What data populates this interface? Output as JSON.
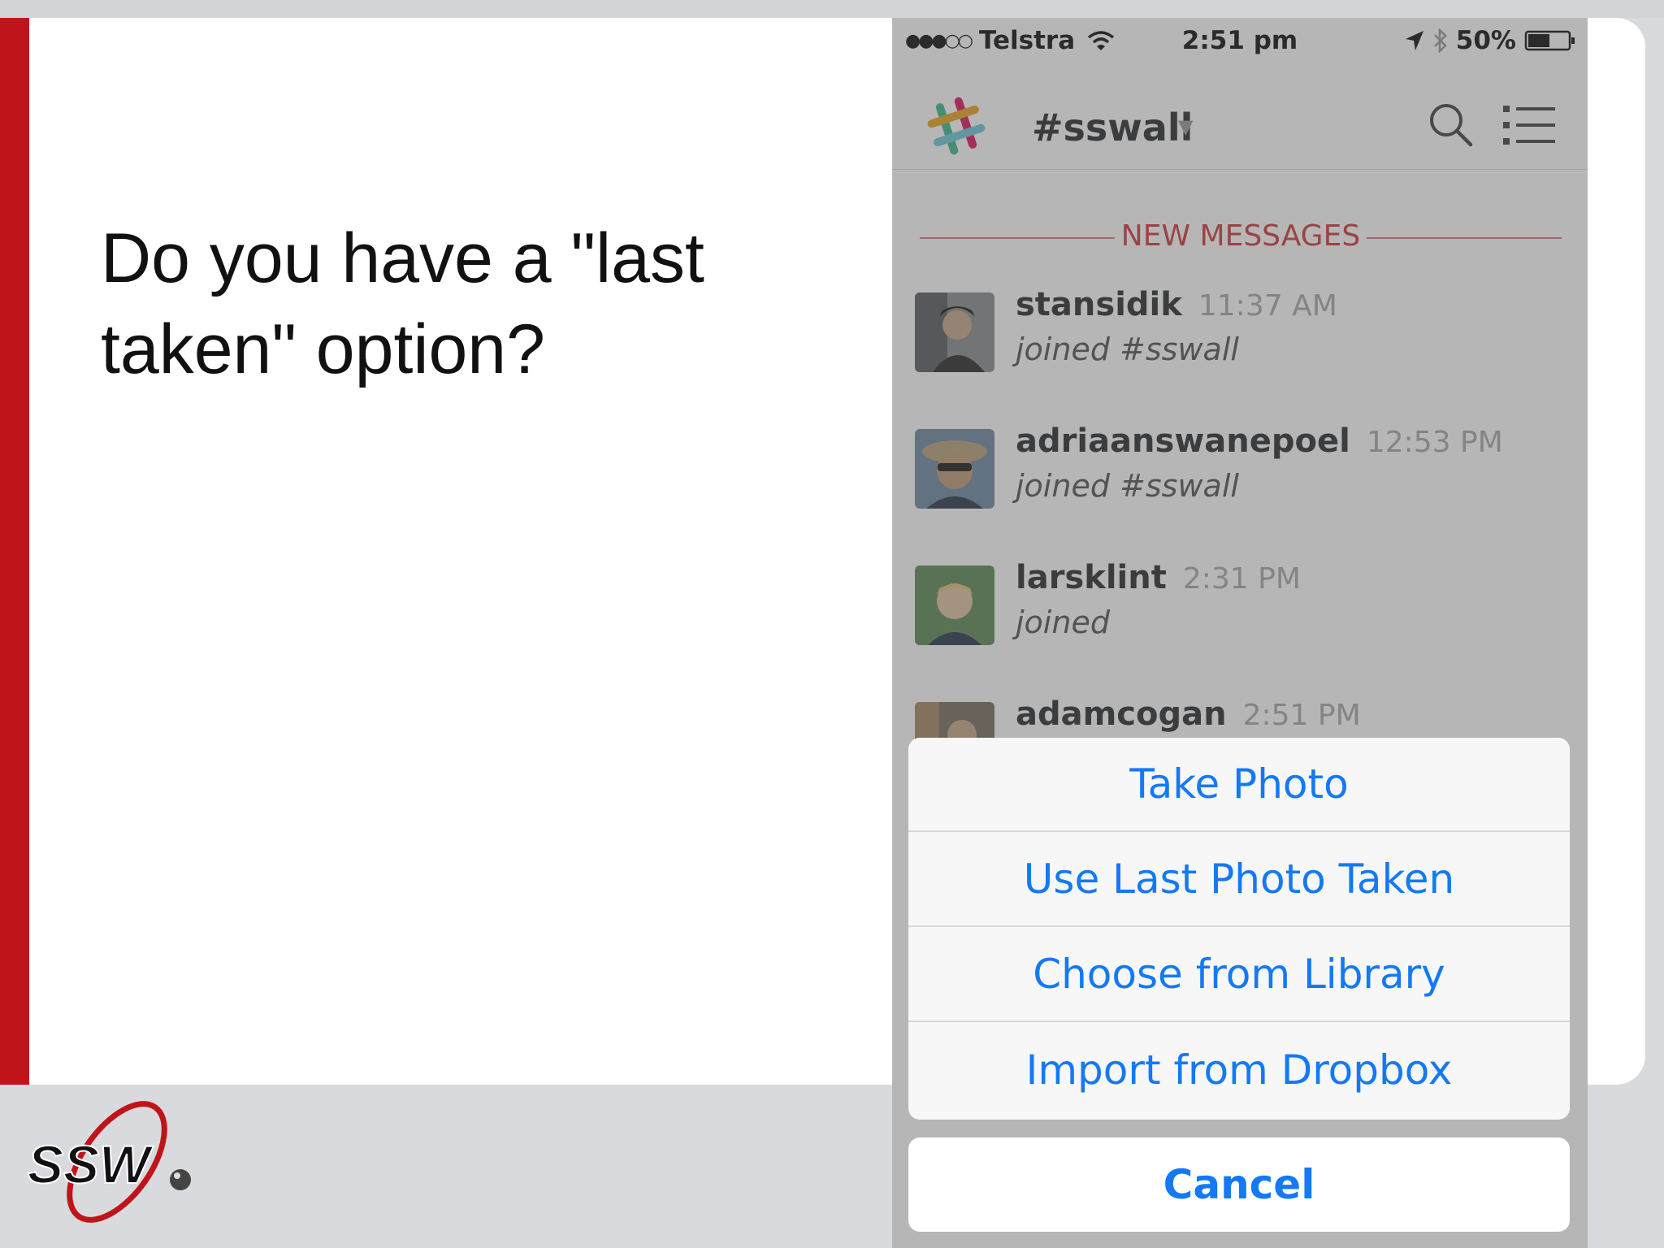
{
  "slide": {
    "question": "Do you have a \"last taken\" option?",
    "logo_text": "SSW",
    "accent_color": "#c0141b"
  },
  "phone": {
    "status_bar": {
      "signal": "●●●○○",
      "carrier": "Telstra",
      "time": "2:51 pm",
      "battery": "50%"
    },
    "nav": {
      "channel": "#sswall",
      "icons": [
        "slack-logo-icon",
        "search-icon",
        "list-icon"
      ]
    },
    "divider_label": "NEW MESSAGES",
    "messages": [
      {
        "user": "stansidik",
        "time": "11:37 AM",
        "text": "joined #sswall"
      },
      {
        "user": "adriaanswanepoel",
        "time": "12:53 PM",
        "text": "joined #sswall"
      },
      {
        "user": "larsklint",
        "time": "2:31 PM",
        "text": "joined"
      },
      {
        "user": "adamcogan",
        "time": "2:51 PM",
        "text": ""
      }
    ],
    "action_sheet": {
      "items": [
        "Take Photo",
        "Use Last Photo Taken",
        "Choose from Library",
        "Import from Dropbox"
      ],
      "cancel": "Cancel",
      "tint_color": "#1479f5"
    }
  }
}
